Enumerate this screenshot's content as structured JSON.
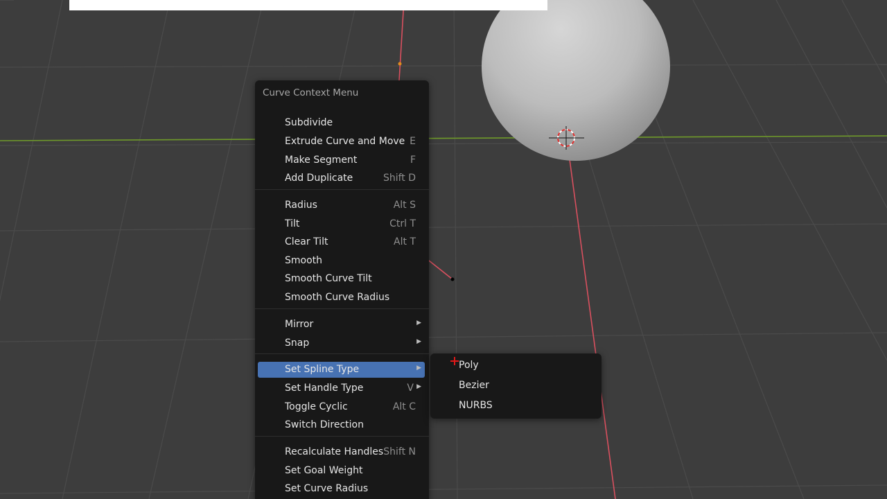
{
  "menu": {
    "title": "Curve Context Menu",
    "items": [
      {
        "label": "Subdivide",
        "shortcut": "",
        "submenu": false,
        "active": false
      },
      {
        "label": "Extrude Curve and Move",
        "shortcut": "E",
        "submenu": false,
        "active": false
      },
      {
        "label": "Make Segment",
        "shortcut": "F",
        "submenu": false,
        "active": false
      },
      {
        "label": "Add Duplicate",
        "shortcut": "Shift D",
        "submenu": false,
        "active": false
      },
      {
        "label": "Radius",
        "shortcut": "Alt S",
        "submenu": false,
        "active": false
      },
      {
        "label": "Tilt",
        "shortcut": "Ctrl T",
        "submenu": false,
        "active": false
      },
      {
        "label": "Clear Tilt",
        "shortcut": "Alt T",
        "submenu": false,
        "active": false
      },
      {
        "label": "Smooth",
        "shortcut": "",
        "submenu": false,
        "active": false
      },
      {
        "label": "Smooth Curve Tilt",
        "shortcut": "",
        "submenu": false,
        "active": false
      },
      {
        "label": "Smooth Curve Radius",
        "shortcut": "",
        "submenu": false,
        "active": false
      },
      {
        "label": "Mirror",
        "shortcut": "",
        "submenu": true,
        "active": false
      },
      {
        "label": "Snap",
        "shortcut": "",
        "submenu": true,
        "active": false
      },
      {
        "label": "Set Spline Type",
        "shortcut": "",
        "submenu": true,
        "active": true
      },
      {
        "label": "Set Handle Type",
        "shortcut": "V",
        "submenu": true,
        "active": false
      },
      {
        "label": "Toggle Cyclic",
        "shortcut": "Alt C",
        "submenu": false,
        "active": false
      },
      {
        "label": "Switch Direction",
        "shortcut": "",
        "submenu": false,
        "active": false
      },
      {
        "label": "Recalculate Handles",
        "shortcut": "Shift N",
        "submenu": false,
        "active": false
      },
      {
        "label": "Set Goal Weight",
        "shortcut": "",
        "submenu": false,
        "active": false
      },
      {
        "label": "Set Curve Radius",
        "shortcut": "",
        "submenu": false,
        "active": false
      }
    ]
  },
  "submenu": {
    "items": [
      {
        "label": "Poly"
      },
      {
        "label": "Bezier"
      },
      {
        "label": "NURBS"
      }
    ]
  },
  "colors": {
    "viewport_bg": "#3d3d3d",
    "grid_line": "#4a4a4a",
    "x_axis": "#d9505f",
    "y_axis": "#6f9a2a",
    "menu_bg": "#181818",
    "highlight": "#4772b3",
    "sphere": "#bdbdbd"
  },
  "icons": {
    "submenu_arrow": "triangle-right-icon",
    "cursor_3d": "3d-cursor-icon",
    "mouse_cursor": "crosshair-cursor-icon"
  }
}
